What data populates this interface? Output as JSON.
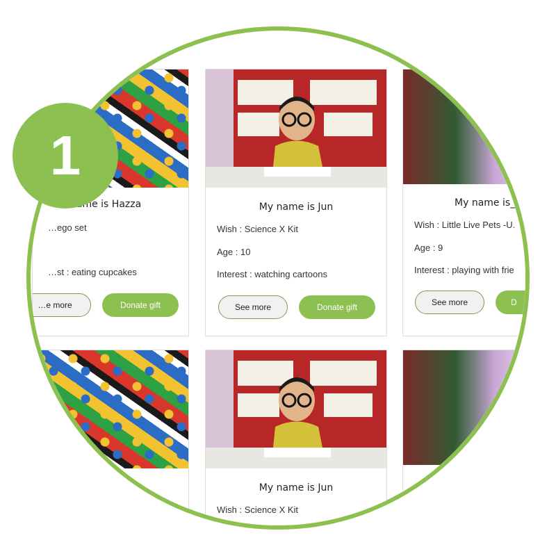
{
  "badge": {
    "number": "1"
  },
  "cards": {
    "c1": {
      "name": "…name is Hazza",
      "wish": "…ego set",
      "interest": "…st : eating cupcakes",
      "see_more": "…e more",
      "donate": "Donate gift"
    },
    "c2": {
      "name": "My name is Jun",
      "wish": "Wish : Science X Kit",
      "age": "Age : 10",
      "interest": "Interest : watching cartoons",
      "see_more": "See more",
      "donate": "Donate gift"
    },
    "c3": {
      "name": "My name is_",
      "wish": "Wish : Little Live Pets -U.",
      "age": "Age : 9",
      "interest": "Interest : playing with frie",
      "see_more": "See more",
      "donate": "D"
    },
    "c5": {
      "name": "My name is Jun",
      "wish": "Wish : Science X Kit"
    }
  },
  "colors": {
    "accent": "#8cc051",
    "outline_border": "#7a9a55",
    "card_border": "#dddddd"
  }
}
